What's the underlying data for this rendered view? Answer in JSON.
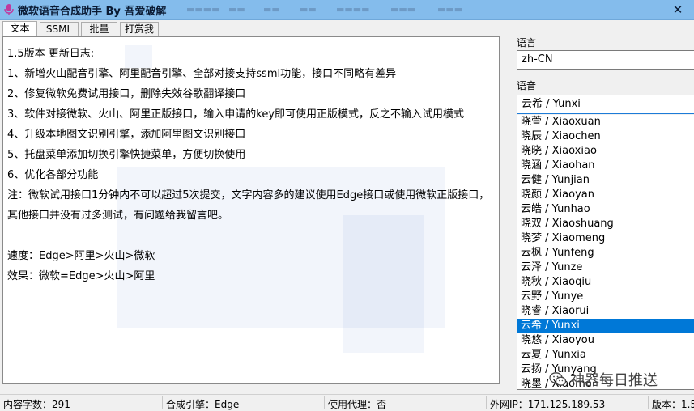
{
  "window": {
    "title": "微软语音合成助手 By 吾爱破解",
    "close_glyph": "✕"
  },
  "tabs": [
    {
      "label": "文本"
    },
    {
      "label": "SSML"
    },
    {
      "label": "批量"
    },
    {
      "label": "打赏我"
    }
  ],
  "content": {
    "lines": [
      "1.5版本 更新日志:",
      "1、新增火山配音引擎、阿里配音引擎、全部对接支持ssml功能，接口不同略有差异",
      "2、修复微软免费试用接口，删除失效谷歌翻译接口",
      "3、软件对接微软、火山、阿里正版接口，输入申请的key即可使用正版模式，反之不输入试用模式",
      "4、升级本地图文识别引擎，添加阿里图文识别接口",
      "5、托盘菜单添加切换引擎快捷菜单，方便切换使用",
      "6、优化各部分功能"
    ],
    "note": "注：微软试用接口1分钟内不可以超过5次提交，文字内容多的建议使用Edge接口或使用微软正版接口，其他接口并没有过多测试，有问题给我留言吧。",
    "speed": "速度：Edge>阿里>火山>微软",
    "effect": "效果：微软=Edge>火山>阿里"
  },
  "language": {
    "label": "语言",
    "value": "zh-CN"
  },
  "voice": {
    "label": "语音",
    "value": "云希 / Yunxi",
    "options": [
      "晓萱 / Xiaoxuan",
      "晓辰 / Xiaochen",
      "晓晓 / Xiaoxiao",
      "晓涵 / Xiaohan",
      "云健 / Yunjian",
      "晓颜 / Xiaoyan",
      "云皓 / Yunhao",
      "晓双 / Xiaoshuang",
      "晓梦 / Xiaomeng",
      "云枫 / Yunfeng",
      "云泽 / Yunze",
      "晓秋 / Xiaoqiu",
      "云野 / Yunye",
      "晓睿 / Xiaorui",
      "云希 / Yunxi",
      "晓悠 / Xiaoyou",
      "云夏 / Yunxia",
      "云扬 / Yunyang",
      "晓墨 / Xiaomo"
    ],
    "selected_index": 14
  },
  "watermark": "神器每日推送",
  "status": {
    "char_count": "内容字数：291",
    "engine": "合成引擎：Edge",
    "proxy": "使用代理：否",
    "ip": "外网IP：171.125.189.53",
    "version": "版本：1.5"
  },
  "colors": {
    "titlebar": "#84bcec",
    "selection": "#0078d7",
    "focus_border": "#1c7bd8"
  }
}
